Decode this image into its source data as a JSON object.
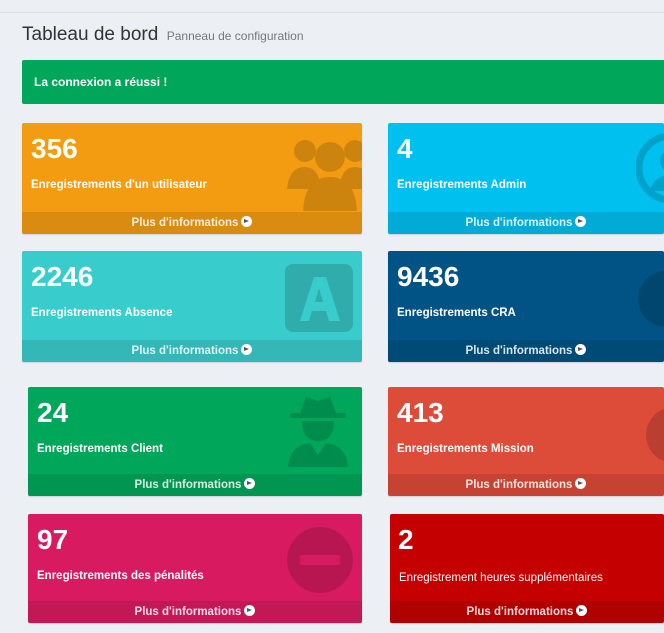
{
  "header": {
    "title": "Tableau de bord",
    "subtitle": "Panneau de configuration"
  },
  "alert": {
    "text": "La connexion a réussi !"
  },
  "boxes": [
    {
      "value": "356",
      "label": "Enregistrements d'un utilisateur",
      "footer": "Plus d'informations",
      "color": "#f39c12",
      "icon": "users-icon"
    },
    {
      "value": "4",
      "label": "Enregistrements Admin",
      "footer": "Plus d'informations",
      "color": "#00c0ef",
      "icon": "user-circle-icon"
    },
    {
      "value": "2246",
      "label": "Enregistrements Absence",
      "footer": "Plus d'informations",
      "color": "#39cccc",
      "icon": "letter-a-icon"
    },
    {
      "value": "9436",
      "label": "Enregistrements CRA",
      "footer": "Plus d'informations",
      "color": "#005384",
      "icon": "circle-icon"
    },
    {
      "value": "24",
      "label": "Enregistrements Client",
      "footer": "Plus d'informations",
      "color": "#00a65a",
      "icon": "spy-icon"
    },
    {
      "value": "413",
      "label": "Enregistrements Mission",
      "footer": "Plus d'informations",
      "color": "#dd4b39",
      "icon": "circle-icon"
    },
    {
      "value": "97",
      "label": "Enregistrements des pénalités",
      "footer": "Plus d'informations",
      "color": "#d81b60",
      "icon": "minus-circle-icon"
    },
    {
      "value": "2",
      "label": "Enregistrement heures supplémentaires",
      "footer": "Plus d'informations",
      "color": "#c50000",
      "icon": ""
    }
  ]
}
